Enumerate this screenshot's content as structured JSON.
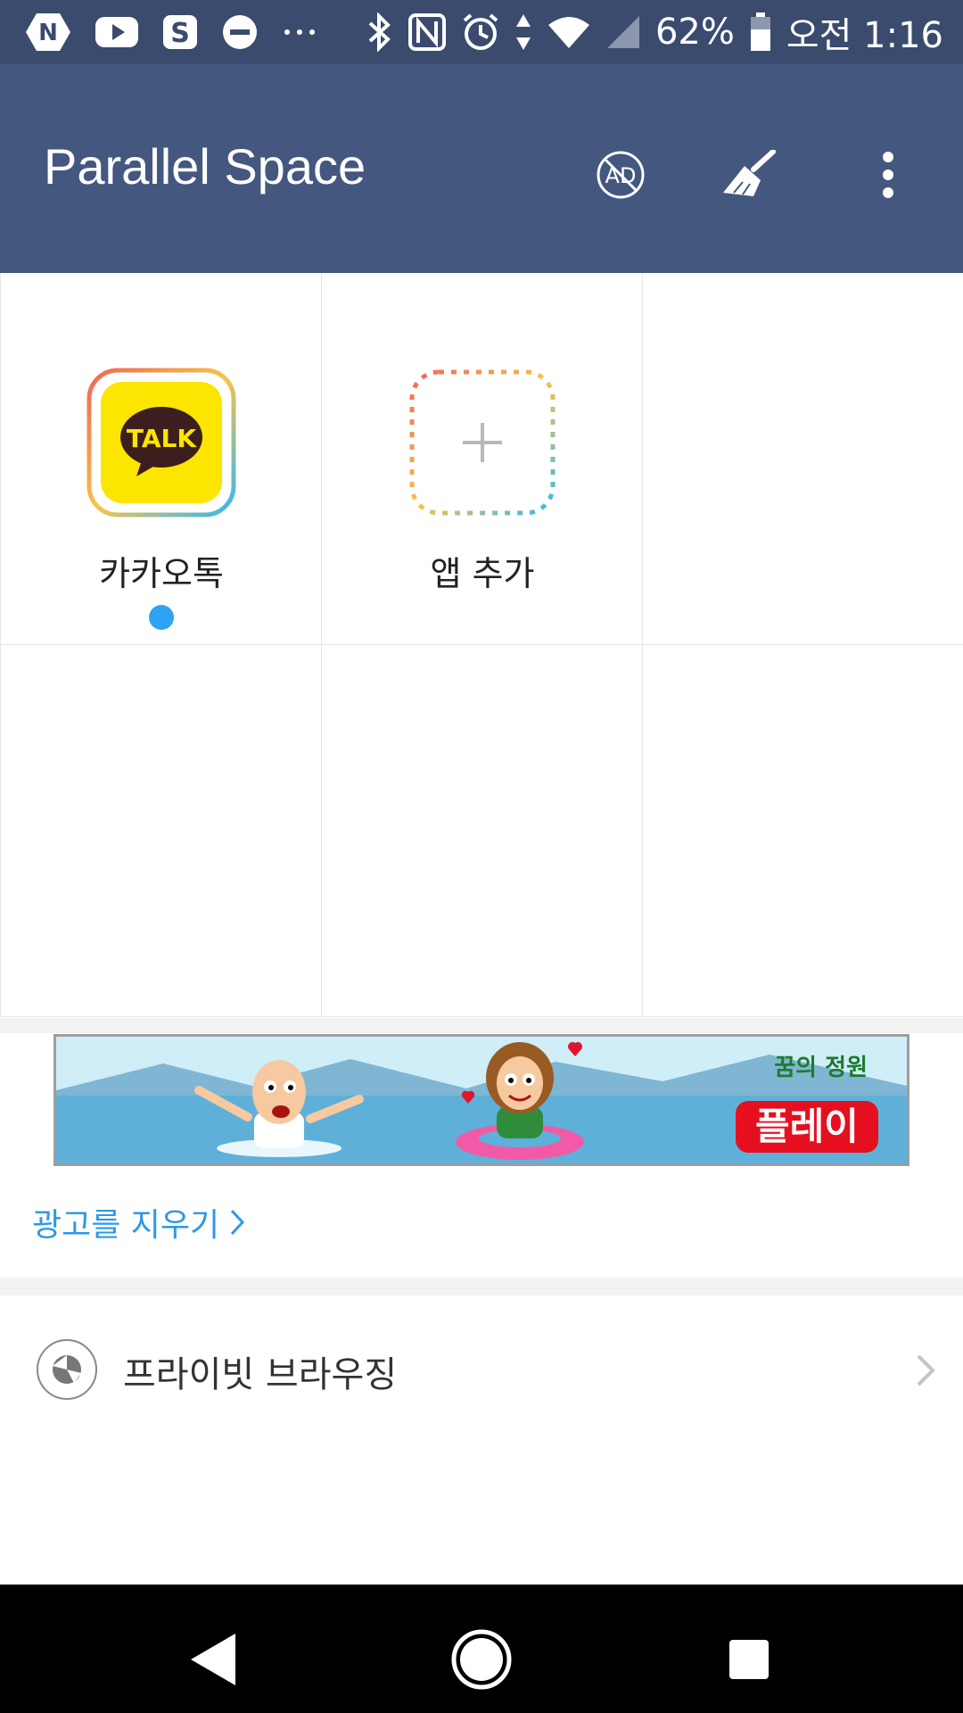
{
  "status_bar": {
    "battery": "62%",
    "time": "오전 1:16",
    "left_icons": [
      "naver-icon",
      "youtube-icon",
      "s-app-icon",
      "dnd-icon",
      "more-notifications-icon"
    ],
    "right_icons": [
      "bluetooth-icon",
      "nfc-icon",
      "alarm-icon",
      "data-arrows-icon",
      "wifi-icon",
      "signal-icon",
      "battery-icon"
    ]
  },
  "app_bar": {
    "title": "Parallel Space",
    "actions": [
      "no-ads-icon",
      "clean-broom-icon",
      "overflow-menu-icon"
    ]
  },
  "apps": [
    {
      "label": "카카오톡",
      "icon": "kakaotalk-icon",
      "icon_text": "TALK",
      "running": true
    },
    {
      "label": "앱 추가",
      "icon": "add-app-icon"
    }
  ],
  "ad": {
    "logo_text": "꿈의 정원",
    "button_label": "플레이"
  },
  "remove_ads": {
    "label": "광고를 지우기"
  },
  "private_browsing": {
    "label": "프라이빗 브라우징"
  },
  "colors": {
    "status_bar": "#3a4b6e",
    "app_bar": "#44577f",
    "accent": "#2ea3f2",
    "link": "#2e98e8",
    "ad_button": "#e60f1f",
    "kakao_yellow": "#fce500"
  },
  "nav_bar": {
    "buttons": [
      "back-icon",
      "home-icon",
      "recents-icon"
    ]
  }
}
